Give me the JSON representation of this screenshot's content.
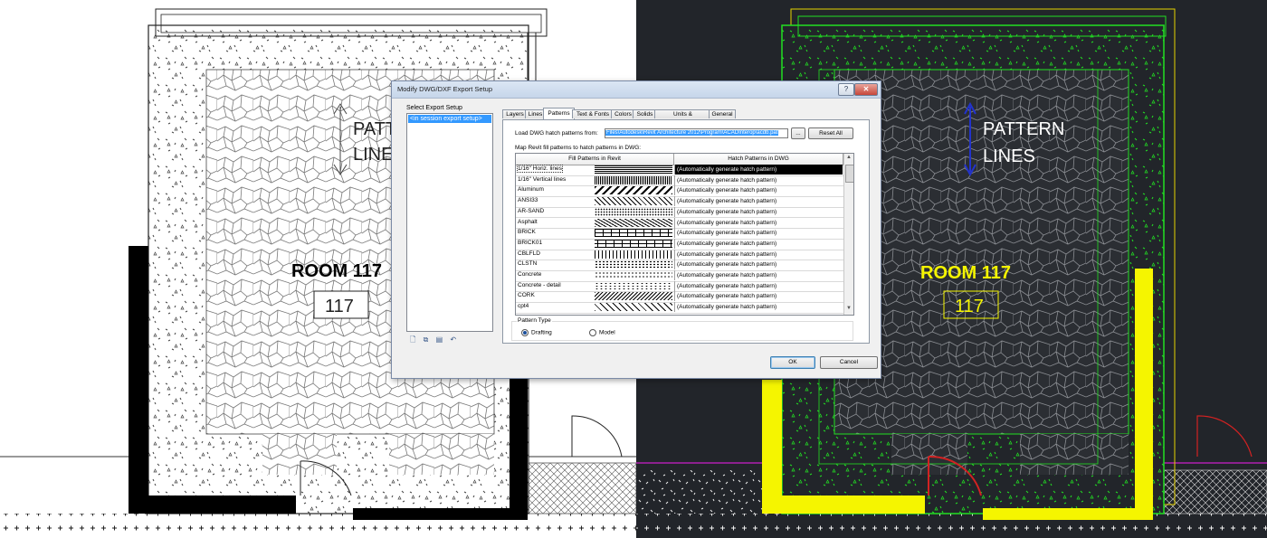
{
  "left_plan": {
    "room_name": "ROOM 117",
    "room_tag": "117",
    "annotation_line1": "PATTERN",
    "annotation_line2": "LINES"
  },
  "right_plan": {
    "room_name": "ROOM 117",
    "room_tag": "117",
    "annotation_line1": "PATTERN",
    "annotation_line2": "LINES"
  },
  "colors": {
    "cad_background": "#22252a",
    "cad_green": "#22e022",
    "cad_yellow": "#f5f500",
    "cad_red": "#d22222",
    "cad_blue": "#2233cc",
    "selection_blue": "#3399ff"
  },
  "dialog": {
    "title": "Modify DWG/DXF Export Setup",
    "help_icon": "question-icon",
    "close_icon": "close-icon",
    "select_setup_label": "Select Export Setup",
    "setup_items": [
      "<in session export setup>"
    ],
    "setup_tool_icons": [
      "new-setup-icon",
      "duplicate-setup-icon",
      "rename-setup-icon",
      "delete-setup-icon"
    ],
    "tabs": [
      "Layers",
      "Lines",
      "Patterns",
      "Text & Fonts",
      "Colors",
      "Solids",
      "Units & Coordinates",
      "General"
    ],
    "active_tab": "Patterns",
    "load_label": "Load DWG hatch patterns from:",
    "load_path": "Files\\Autodesk\\Revit Architecture 2012\\Program\\ACADInterop\\acdb.pat",
    "browse_label": "...",
    "reset_label": "Reset All",
    "map_label": "Map Revit fill patterns to hatch patterns in DWG:",
    "col_fill": "Fill Patterns in Revit",
    "col_dwg": "Hatch Patterns in DWG",
    "rows": [
      {
        "name": "1/16\" Horiz. lines",
        "dwg": "(Automatically generate hatch pattern)",
        "selected": true
      },
      {
        "name": "1/16\" Vertical lines",
        "dwg": "(Automatically generate hatch pattern)"
      },
      {
        "name": "Aluminum",
        "dwg": "(Automatically generate hatch pattern)"
      },
      {
        "name": "ANSI33",
        "dwg": "(Automatically generate hatch pattern)"
      },
      {
        "name": "AR-SAND",
        "dwg": "(Automatically generate hatch pattern)"
      },
      {
        "name": "Asphalt",
        "dwg": "(Automatically generate hatch pattern)"
      },
      {
        "name": "BRICK",
        "dwg": "(Automatically generate hatch pattern)"
      },
      {
        "name": "BRICK01",
        "dwg": "(Automatically generate hatch pattern)"
      },
      {
        "name": "CBLFLD",
        "dwg": "(Automatically generate hatch pattern)"
      },
      {
        "name": "CLSTN",
        "dwg": "(Automatically generate hatch pattern)"
      },
      {
        "name": "Concrete",
        "dwg": "(Automatically generate hatch pattern)"
      },
      {
        "name": "Concrete - detail",
        "dwg": "(Automatically generate hatch pattern)"
      },
      {
        "name": "CORK",
        "dwg": "(Automatically generate hatch pattern)"
      },
      {
        "name": "cpt4",
        "dwg": "(Automatically generate hatch pattern)"
      }
    ],
    "pattern_type_label": "Pattern Type",
    "radio_drafting": "Drafting",
    "radio_model": "Model",
    "selected_pattern_type": "Drafting",
    "ok_label": "OK",
    "cancel_label": "Cancel"
  }
}
